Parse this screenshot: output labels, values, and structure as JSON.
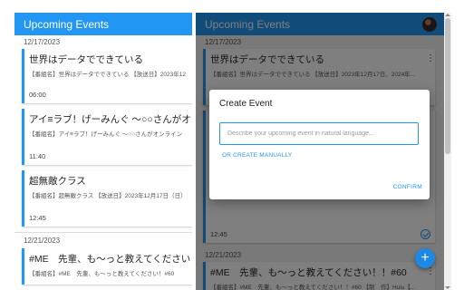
{
  "app": {
    "title": "Upcoming Events"
  },
  "colors": {
    "primary": "#2196f3",
    "fab": "#1e88e5"
  },
  "left_panel": {
    "groups": [
      {
        "date": "12/17/2023",
        "events": [
          {
            "title": "世界はデータでできている",
            "desc": "【番組名】世界はデータでできている 【放送日】2023年12",
            "time": "06:00"
          },
          {
            "title": "アイ≡ラブ！げーみんぐ ～○○さんがオン",
            "desc": "【番組名】アイ≡ラブ！げーみんぐ ～○○さんがオンライン",
            "time": "11:40"
          },
          {
            "title": "超無敵クラス",
            "desc": "【番組名】超無敵クラス 【放送日】2023年12月17日（日）",
            "time": "12:45"
          }
        ]
      },
      {
        "date": "12/21/2023",
        "events": [
          {
            "title": "#ME　先輩、も～っと教えてください！",
            "desc": "【番組名】#ME　先輩、も～っと教えてください！#60"
          }
        ]
      }
    ]
  },
  "right_panel": {
    "groups": [
      {
        "date": "12/17/2023",
        "events": [
          {
            "title": "世界はデータでできている",
            "desc": "【番組名】世界はデータでできている 【放送日】2023年12月17日、2024年..."
          },
          {
            "time": "12:45"
          }
        ]
      },
      {
        "date": "12/21/2023",
        "events": [
          {
            "title": "#ME　先輩、も～っと教えてください！！#60",
            "desc": "【番組名】#ME　先輩、も～っと教えてください！！#60 【制　作】Hulu【..."
          }
        ]
      }
    ]
  },
  "dialog": {
    "title": "Create Event",
    "input_placeholder": "Describe your upcoming event in natural language...",
    "input_value": "",
    "create_manually_label": "OR CREATE MANUALLY",
    "confirm_label": "CONFIRM"
  },
  "icons": {
    "kebab": "more-vert-icon",
    "check": "check-circle-icon",
    "fab": "add-icon",
    "fab_glyph": "+",
    "kebab_glyph": "⋮"
  }
}
